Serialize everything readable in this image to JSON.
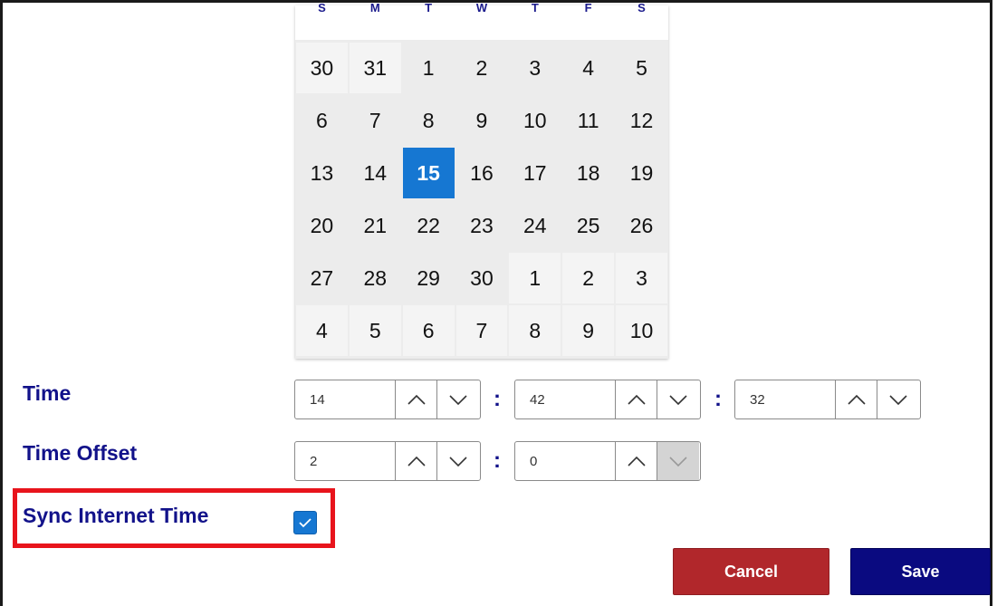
{
  "calendar": {
    "weekdays": [
      "S",
      "M",
      "T",
      "W",
      "T",
      "F",
      "S"
    ],
    "weeks": [
      [
        {
          "d": "30",
          "t": "other"
        },
        {
          "d": "31",
          "t": "other"
        },
        {
          "d": "1",
          "t": "current"
        },
        {
          "d": "2",
          "t": "current"
        },
        {
          "d": "3",
          "t": "current"
        },
        {
          "d": "4",
          "t": "current"
        },
        {
          "d": "5",
          "t": "current"
        }
      ],
      [
        {
          "d": "6",
          "t": "current"
        },
        {
          "d": "7",
          "t": "current"
        },
        {
          "d": "8",
          "t": "current"
        },
        {
          "d": "9",
          "t": "current"
        },
        {
          "d": "10",
          "t": "current"
        },
        {
          "d": "11",
          "t": "current"
        },
        {
          "d": "12",
          "t": "current"
        }
      ],
      [
        {
          "d": "13",
          "t": "current"
        },
        {
          "d": "14",
          "t": "current"
        },
        {
          "d": "15",
          "t": "selected"
        },
        {
          "d": "16",
          "t": "current"
        },
        {
          "d": "17",
          "t": "current"
        },
        {
          "d": "18",
          "t": "current"
        },
        {
          "d": "19",
          "t": "current"
        }
      ],
      [
        {
          "d": "20",
          "t": "current"
        },
        {
          "d": "21",
          "t": "current"
        },
        {
          "d": "22",
          "t": "current"
        },
        {
          "d": "23",
          "t": "current"
        },
        {
          "d": "24",
          "t": "current"
        },
        {
          "d": "25",
          "t": "current"
        },
        {
          "d": "26",
          "t": "current"
        }
      ],
      [
        {
          "d": "27",
          "t": "current"
        },
        {
          "d": "28",
          "t": "current"
        },
        {
          "d": "29",
          "t": "current"
        },
        {
          "d": "30",
          "t": "current"
        },
        {
          "d": "1",
          "t": "other"
        },
        {
          "d": "2",
          "t": "other"
        },
        {
          "d": "3",
          "t": "other"
        }
      ],
      [
        {
          "d": "4",
          "t": "other"
        },
        {
          "d": "5",
          "t": "other"
        },
        {
          "d": "6",
          "t": "other"
        },
        {
          "d": "7",
          "t": "other"
        },
        {
          "d": "8",
          "t": "other"
        },
        {
          "d": "9",
          "t": "other"
        },
        {
          "d": "10",
          "t": "other"
        }
      ]
    ]
  },
  "time": {
    "label": "Time",
    "hours": "14",
    "minutes": "42",
    "seconds": "32",
    "separator": ":"
  },
  "offset": {
    "label": "Time Offset",
    "hours": "2",
    "minutes": "0",
    "separator": ":"
  },
  "sync": {
    "label": "Sync Internet Time",
    "checked": true
  },
  "actions": {
    "cancel_label": "Cancel",
    "save_label": "Save"
  },
  "colors": {
    "accent": "#1677d2",
    "label": "#12128a",
    "cancel": "#b1272b",
    "save": "#0a0a80",
    "highlight": "#e8141c"
  },
  "icons": {
    "increment": "chevron-up-icon",
    "decrement": "chevron-down-icon",
    "checkmark": "checkmark-icon"
  }
}
